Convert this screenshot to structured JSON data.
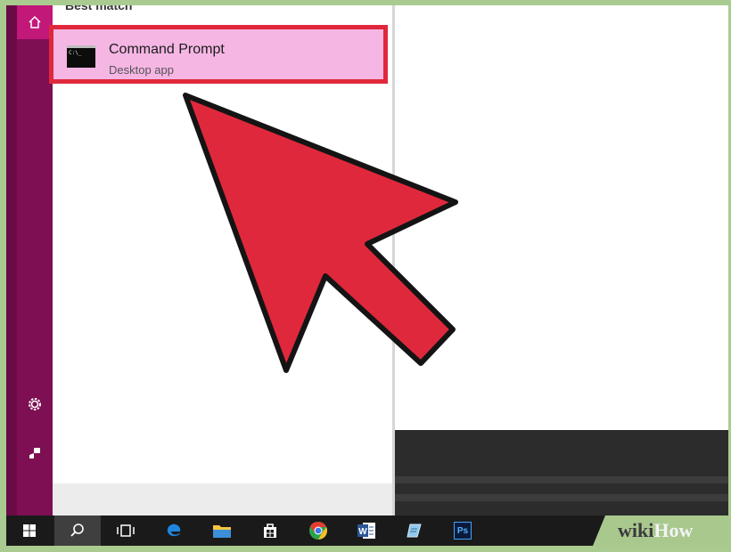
{
  "search_panel": {
    "section_heading": "Best match",
    "best_result": {
      "title": "Command Prompt",
      "subtitle": "Desktop app",
      "icon": "command-prompt-icon",
      "icon_text": "C:\\_"
    },
    "highlight_color": "#e0283c",
    "selection_color": "#f5b6e4"
  },
  "sidebar": {
    "icons": [
      "home-icon",
      "settings-gear-icon",
      "user-feedback-icon"
    ],
    "accent": "#7d0f52",
    "home_active_color": "#c2187a"
  },
  "taskbar": {
    "items": [
      {
        "name": "start-button",
        "icon": "windows-logo-icon"
      },
      {
        "name": "search-button",
        "icon": "search-icon",
        "active": true
      },
      {
        "name": "task-view-button",
        "icon": "task-view-icon"
      },
      {
        "name": "edge-button",
        "icon": "edge-icon"
      },
      {
        "name": "file-explorer-button",
        "icon": "folder-icon"
      },
      {
        "name": "store-button",
        "icon": "store-icon"
      },
      {
        "name": "chrome-button",
        "icon": "chrome-icon"
      },
      {
        "name": "word-button",
        "icon": "word-icon"
      },
      {
        "name": "notepad-button",
        "icon": "notepad-icon"
      },
      {
        "name": "photoshop-button",
        "icon": "photoshop-icon",
        "label": "Ps"
      }
    ]
  },
  "annotation": {
    "type": "arrow-pointer",
    "fill": "#e0283c"
  },
  "watermark": {
    "part1": "wiki",
    "part2": "How"
  }
}
